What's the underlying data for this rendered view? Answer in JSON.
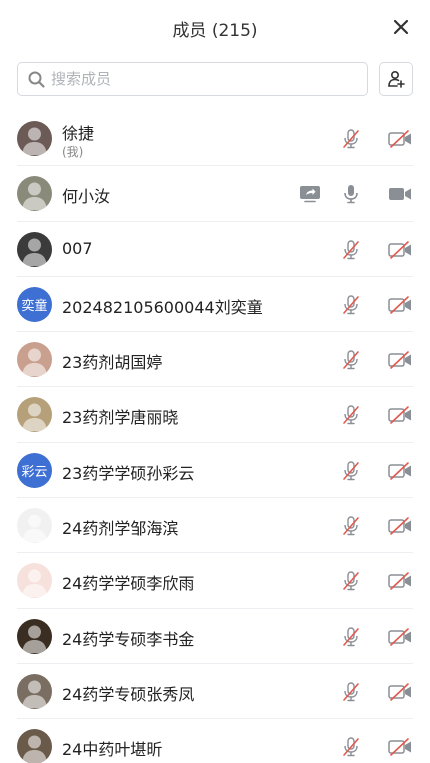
{
  "header": {
    "title": "成员 (215)"
  },
  "search": {
    "placeholder": "搜索成员"
  },
  "members": [
    {
      "name": "徐捷",
      "sub": "(我)",
      "avatar_label": "",
      "avatar_bg": "#6b5a55",
      "mic": "muted",
      "cam": "off",
      "sharing": false
    },
    {
      "name": "何小汝",
      "sub": "",
      "avatar_label": "",
      "avatar_bg": "#8a8a7a",
      "mic": "on",
      "cam": "on",
      "sharing": true
    },
    {
      "name": "007",
      "sub": "",
      "avatar_label": "",
      "avatar_bg": "#3b3b3b",
      "mic": "muted",
      "cam": "off",
      "sharing": false
    },
    {
      "name": "202482105600044刘奕童",
      "sub": "",
      "avatar_label": "奕童",
      "avatar_bg": "#3e6fd2",
      "mic": "muted",
      "cam": "off",
      "sharing": false
    },
    {
      "name": "23药剂胡国婷",
      "sub": "",
      "avatar_label": "",
      "avatar_bg": "#c9a08e",
      "mic": "muted",
      "cam": "off",
      "sharing": false
    },
    {
      "name": "23药剂学唐丽晓",
      "sub": "",
      "avatar_label": "",
      "avatar_bg": "#b5a07a",
      "mic": "muted",
      "cam": "off",
      "sharing": false
    },
    {
      "name": "23药学学硕孙彩云",
      "sub": "",
      "avatar_label": "彩云",
      "avatar_bg": "#3e6fd2",
      "mic": "muted",
      "cam": "off",
      "sharing": false
    },
    {
      "name": "24药剂学邹海滨",
      "sub": "",
      "avatar_label": "",
      "avatar_bg": "#f1f1f1",
      "mic": "muted",
      "cam": "off",
      "sharing": false
    },
    {
      "name": "24药学学硕李欣雨",
      "sub": "",
      "avatar_label": "",
      "avatar_bg": "#f6e1dc",
      "mic": "muted",
      "cam": "off",
      "sharing": false
    },
    {
      "name": "24药学专硕李书金",
      "sub": "",
      "avatar_label": "",
      "avatar_bg": "#3a2e22",
      "mic": "muted",
      "cam": "off",
      "sharing": false
    },
    {
      "name": "24药学专硕张秀凤",
      "sub": "",
      "avatar_label": "",
      "avatar_bg": "#7a6d62",
      "mic": "muted",
      "cam": "off",
      "sharing": false
    },
    {
      "name": "24中药叶堪昕",
      "sub": "",
      "avatar_label": "",
      "avatar_bg": "#6a5a4a",
      "mic": "muted",
      "cam": "off",
      "sharing": false
    }
  ],
  "colors": {
    "accent": "#3e6fd2",
    "muted_slash": "#e05a4f",
    "icon_gray": "#8a8f96"
  }
}
